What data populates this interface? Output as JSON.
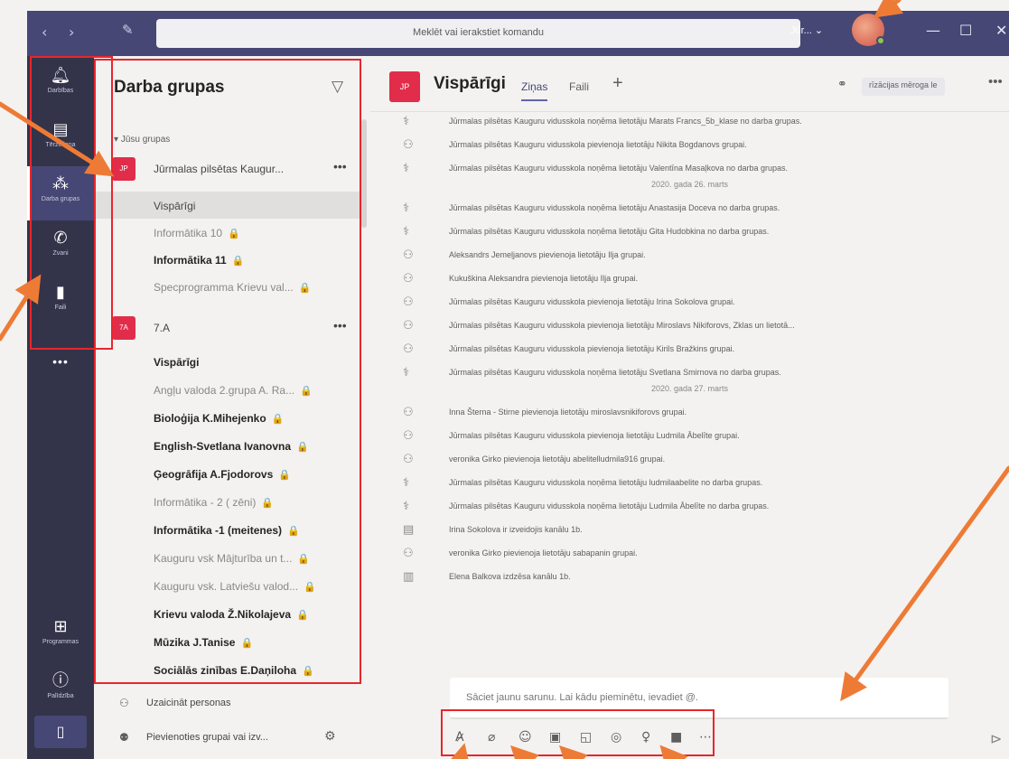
{
  "titlebar": {
    "back": "‹",
    "forward": "›",
    "search_placeholder": "Meklēt vai ierakstiet komandu",
    "tenant": "Jūr... ⌄",
    "minimize": "—",
    "maximize": "☐",
    "close": "✕"
  },
  "rail": {
    "items": [
      {
        "label": "Darbības",
        "icon": "bell-icon"
      },
      {
        "label": "Tērzēšana",
        "icon": "chat-icon"
      },
      {
        "label": "Darba grupas",
        "icon": "teams-icon"
      },
      {
        "label": "Zvani",
        "icon": "phone-icon"
      },
      {
        "label": "Faili",
        "icon": "file-icon"
      }
    ],
    "more": "•••",
    "apps": "Programmas",
    "help": "Palīdzība"
  },
  "panel": {
    "title": "Darba grupas",
    "section": "Jūsu grupas",
    "teams": [
      {
        "tile": "JP",
        "name": "Jūrmalas pilsētas Kaugur...",
        "more": "•••",
        "channels": [
          {
            "name": "Vispārīgi",
            "lock": ""
          },
          {
            "name": "Informātika 10",
            "lock": "🔒"
          },
          {
            "name": "Informātika 11",
            "lock": "🔒"
          },
          {
            "name": "Specprogramma Krievu val...",
            "lock": "🔒"
          }
        ]
      },
      {
        "tile": "7A",
        "name": "7.A",
        "more": "•••",
        "channels": [
          {
            "name": "Vispārīgi",
            "lock": ""
          },
          {
            "name": "Angļu valoda 2.grupa A. Ra...",
            "lock": "🔒"
          },
          {
            "name": "Bioloģija K.Mihejenko",
            "lock": "🔒"
          },
          {
            "name": "English-Svetlana Ivanovna",
            "lock": "🔒"
          },
          {
            "name": "Ģeogrāfija A.Fjodorovs",
            "lock": "🔒"
          },
          {
            "name": "Informātika - 2 ( zēni)",
            "lock": "🔒"
          },
          {
            "name": "Informātika -1 (meitenes)",
            "lock": "🔒"
          },
          {
            "name": "Kauguru vsk Mājturība un t...",
            "lock": "🔒"
          },
          {
            "name": "Kauguru vsk. Latviešu valod...",
            "lock": "🔒"
          },
          {
            "name": "Krievu valoda Ž.Nikolajeva",
            "lock": "🔒"
          },
          {
            "name": "Mūzika J.Tanise",
            "lock": "🔒"
          },
          {
            "name": "Sociālās zinības E.Daņiloha",
            "lock": "🔒"
          }
        ]
      }
    ],
    "invite": "Uzaicināt personas",
    "join": "Pievienoties grupai vai izv..."
  },
  "main": {
    "tile": "JP",
    "title": "Vispārīgi",
    "tabs": [
      "Ziņas",
      "Faili"
    ],
    "add_tab": "+",
    "org_pill": "rīzācijas mēroga le",
    "more": "•••",
    "events": [
      {
        "icon": "remove-user-icon",
        "text": "Jūrmalas pilsētas Kauguru vidusskola noņēma lietotāju Marats Francs_5b_klase no darba grupas."
      },
      {
        "icon": "add-user-icon",
        "text": "Jūrmalas pilsētas Kauguru vidusskola pievienoja lietotāju Nikita Bogdanovs grupai."
      },
      {
        "icon": "remove-user-icon",
        "text": "Jūrmalas pilsētas Kauguru vidusskola noņēma lietotāju Valentīna Masaļkova no darba grupas."
      },
      {
        "date": "2020. gada 26. marts"
      },
      {
        "icon": "remove-user-icon",
        "text": "Jūrmalas pilsētas Kauguru vidusskola noņēma lietotāju Anastasija Doceva no darba grupas."
      },
      {
        "icon": "remove-user-icon",
        "text": "Jūrmalas pilsētas Kauguru vidusskola noņēma lietotāju Gita Hudobkina no darba grupas."
      },
      {
        "icon": "add-user-icon",
        "text": "Aleksandrs Jemeļjanovs pievienoja lietotāju Ilja grupai."
      },
      {
        "icon": "add-user-icon",
        "text": "Kukuškina Aleksandra pievienoja lietotāju Ilja grupai."
      },
      {
        "icon": "add-user-icon",
        "text": "Jūrmalas pilsētas Kauguru vidusskola pievienoja lietotāju Irina Sokolova grupai."
      },
      {
        "icon": "add-user-icon",
        "text": "Jūrmalas pilsētas Kauguru vidusskola pievienoja lietotāju Miroslavs Nikiforovs, Zklas un lietotā..."
      },
      {
        "icon": "add-user-icon",
        "text": "Jūrmalas pilsētas Kauguru vidusskola pievienoja lietotāju Kirils Bražkins grupai."
      },
      {
        "icon": "remove-user-icon",
        "text": "Jūrmalas pilsētas Kauguru vidusskola noņēma lietotāju Svetlana Smirnova no darba grupas."
      },
      {
        "date": "2020. gada 27. marts"
      },
      {
        "icon": "add-user-icon",
        "text": "Inna Šterna - Stirne pievienoja lietotāju miroslavsnikiforovs grupai."
      },
      {
        "icon": "add-user-icon",
        "text": "Jūrmalas pilsētas Kauguru vidusskola pievienoja lietotāju Ludmila Ābelīte grupai."
      },
      {
        "icon": "add-user-icon",
        "text": "veronika Girko pievienoja lietotāju abelitelludmila916 grupai."
      },
      {
        "icon": "remove-user-icon",
        "text": "Jūrmalas pilsētas Kauguru vidusskola noņēma lietotāju ludmilaabelite no darba grupas."
      },
      {
        "icon": "remove-user-icon",
        "text": "Jūrmalas pilsētas Kauguru vidusskola noņēma lietotāju Ludmila Ābelīte no darba grupas."
      },
      {
        "icon": "channel-icon",
        "text": "Irina Sokolova ir izveidojis kanālu 1b."
      },
      {
        "icon": "add-user-icon",
        "text": "veronika Girko pievienoja lietotāju sabapanin grupai."
      },
      {
        "icon": "delete-icon",
        "text": "Elena Balkova izdzēsa kanālu 1b."
      }
    ],
    "composer_placeholder": "Sāciet jaunu sarunu. Lai kādu pieminētu, ievadiet @.",
    "toolbar": [
      "format-icon",
      "attach-icon",
      "emoji-icon",
      "gif-icon",
      "sticker-icon",
      "meet-icon",
      "praise-icon",
      "video-icon",
      "more-icon"
    ]
  },
  "colors": {
    "rail": "#33344a",
    "titlebar": "#464775",
    "accent": "#6264a7",
    "team_tile": "#e12d4a",
    "annotation_box": "#e8262c",
    "annotation_arrow": "#ee7b35"
  }
}
